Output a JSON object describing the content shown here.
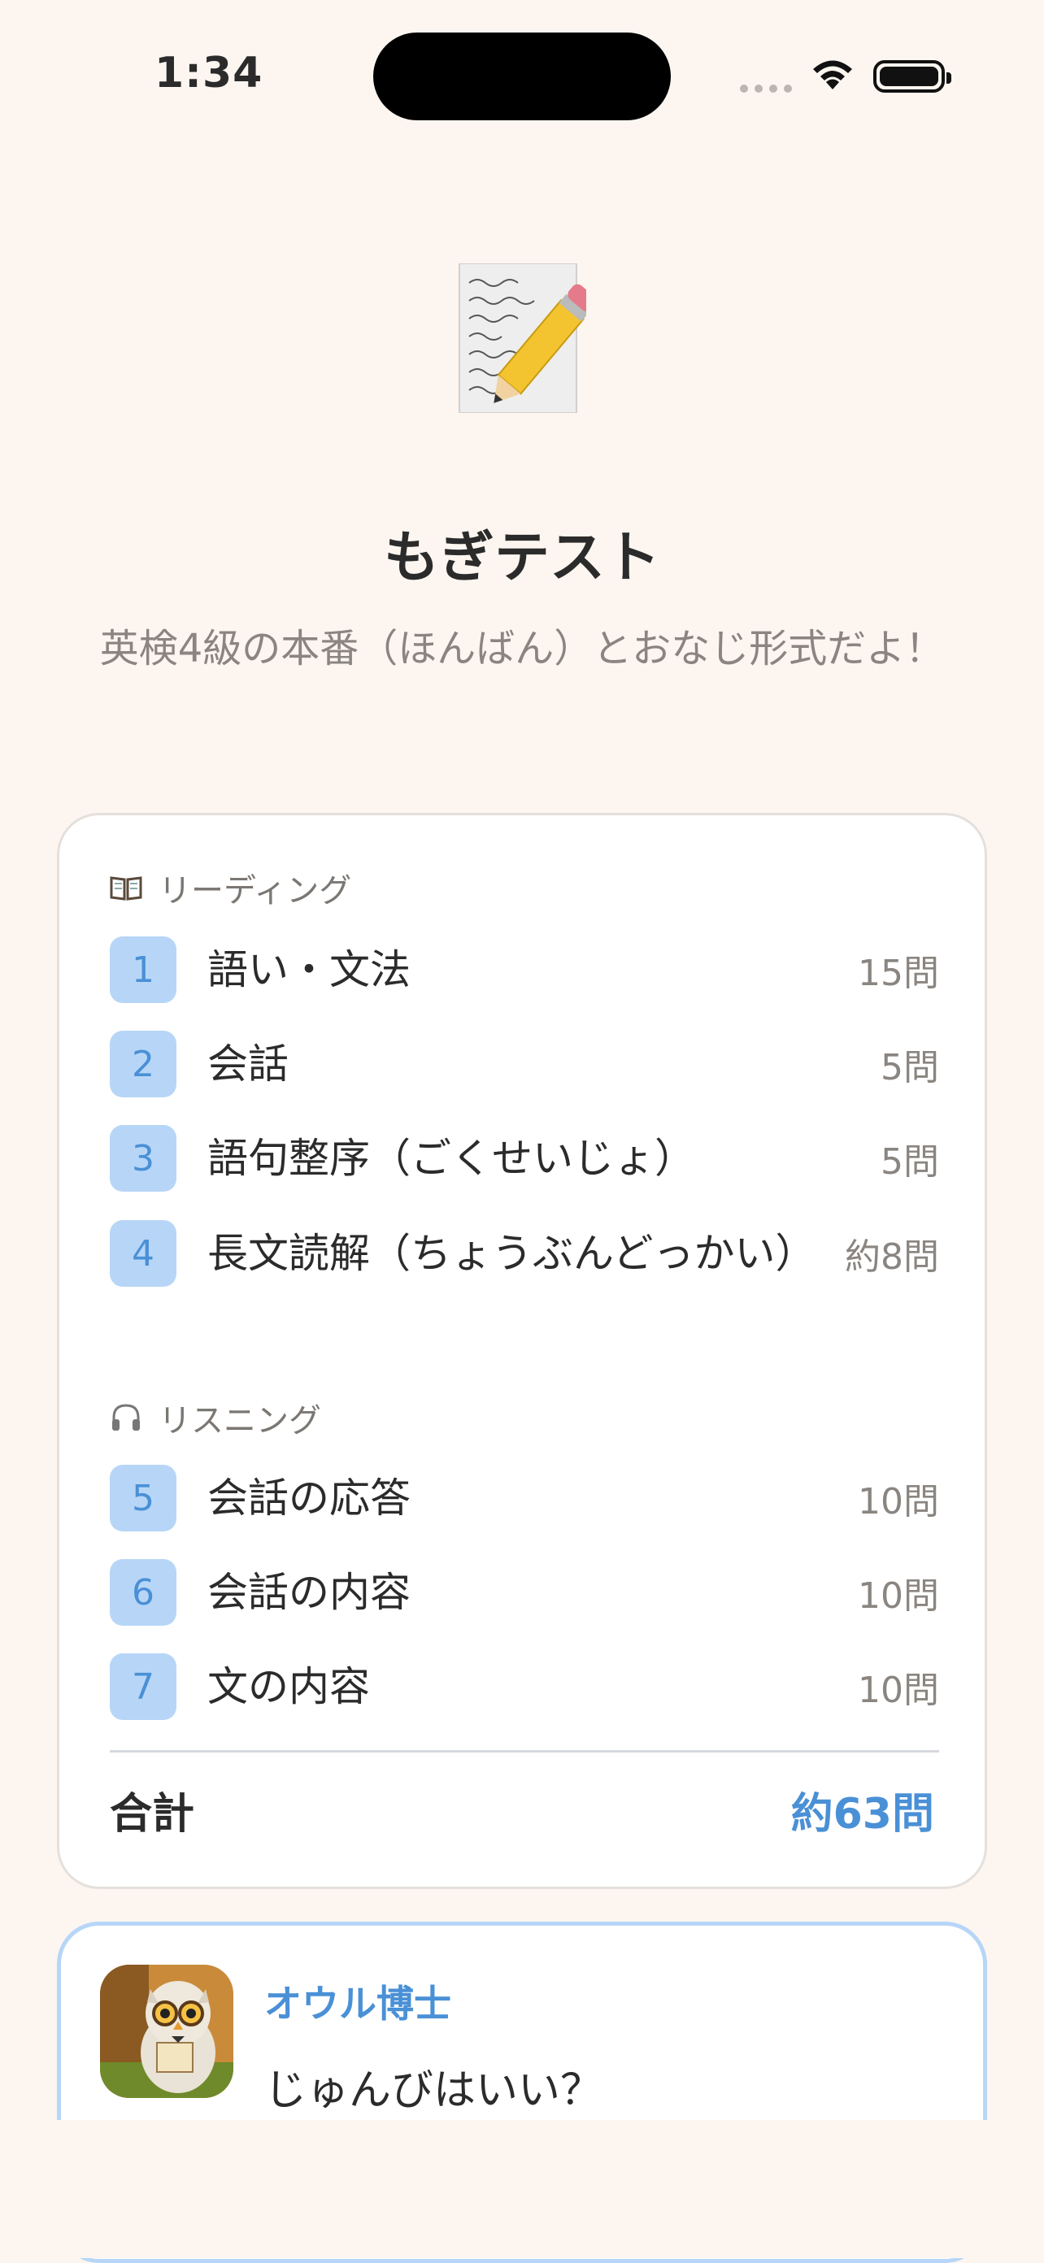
{
  "status_bar": {
    "time": "1:34"
  },
  "header": {
    "icon": "memo-pencil-icon",
    "title": "もぎテスト",
    "subtitle": "英検4級の本番（ほんばん）とおなじ形式だよ！"
  },
  "reading": {
    "icon": "open-book-icon",
    "label": "リーディング",
    "items": [
      {
        "num": "1",
        "label": "語い・文法",
        "count": "15問"
      },
      {
        "num": "2",
        "label": "会話",
        "count": "5問"
      },
      {
        "num": "3",
        "label": "語句整序（ごくせいじょ）",
        "count": "5問"
      },
      {
        "num": "4",
        "label": "長文読解（ちょうぶんどっかい）",
        "count": "約8問"
      }
    ]
  },
  "listening": {
    "icon": "headphones-icon",
    "label": "リスニング",
    "items": [
      {
        "num": "5",
        "label": "会話の応答",
        "count": "10問"
      },
      {
        "num": "6",
        "label": "会話の内容",
        "count": "10問"
      },
      {
        "num": "7",
        "label": "文の内容",
        "count": "10問"
      }
    ]
  },
  "total": {
    "label": "合計",
    "value": "約63問"
  },
  "owl": {
    "avatar": "owl-professor-avatar",
    "name": "オウル博士",
    "message": "じゅんびはいい？"
  },
  "colors": {
    "background": "#fdf6f0",
    "accent": "#4a90d6",
    "badge_bg": "#b7d6f7",
    "muted_text": "#8a8580"
  }
}
